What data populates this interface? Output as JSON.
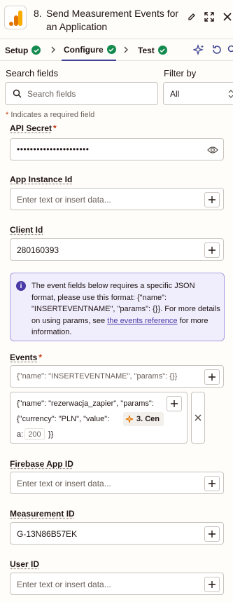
{
  "header": {
    "step_number": "8.",
    "step_title": "Send Measurement Events for an Application",
    "app_icon": "google-analytics-icon",
    "actions": [
      "edit-icon",
      "expand-icon",
      "close-icon"
    ]
  },
  "tabs": [
    {
      "label": "Setup",
      "status": "complete"
    },
    {
      "label": "Configure",
      "status": "complete",
      "active": true
    },
    {
      "label": "Test",
      "status": "complete"
    }
  ],
  "toolbar_icons": [
    "sparkle-icon",
    "refresh-icon",
    "search-icon"
  ],
  "search": {
    "label": "Search fields",
    "placeholder": "Search fields"
  },
  "filter": {
    "label": "Filter by",
    "value": "All"
  },
  "required_note": {
    "star": "*",
    "text": " Indicates a required field"
  },
  "fields": {
    "api_secret": {
      "label": "API Secret",
      "required": "*",
      "value": "••••••••••••••••••••••"
    },
    "app_instance_id": {
      "label": "App Instance Id",
      "placeholder": "Enter text or insert data..."
    },
    "client_id": {
      "label": "Client Id",
      "value": "280160393"
    },
    "events": {
      "label": "Events",
      "required": "*",
      "placeholder": "{\"name\": \"INSERTEVENTNAME\", \"params\": {}}",
      "value_line1": "{\"name\": \"rezerwacja_zapier\", \"params\":",
      "value_line2": "{\"currency\": \"PLN\", \"value\":",
      "pill_label": "3. Cen",
      "pill_cont": "a:",
      "pill_value": "200",
      "value_end": "}}"
    },
    "firebase_app_id": {
      "label": "Firebase App ID",
      "placeholder": "Enter text or insert data..."
    },
    "measurement_id": {
      "label": "Measurement ID",
      "value": "G-13N86B57EK"
    },
    "user_id": {
      "label": "User ID",
      "placeholder": "Enter text or insert data..."
    }
  },
  "info_box": {
    "text": "The event fields below requires a specific JSON format, please use this format: {\"name\": \"INSERTEVENTNAME\", \"params\": {}}. For more details on using params, see ",
    "link": "the events reference",
    "text_after": " for more information."
  },
  "colors": {
    "accent": "#3d4592",
    "success": "#138b4f",
    "required": "#c2380e",
    "info_bg": "#f0eefc"
  }
}
